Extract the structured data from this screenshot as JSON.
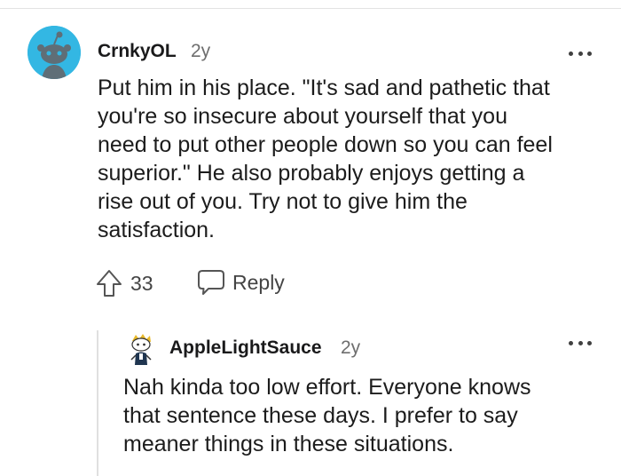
{
  "comment": {
    "username": "CrnkyOL",
    "age": "2y",
    "body_lines": [
      "Put him in his place. \"It's sad and pathetic that",
      "you're so insecure about yourself that you",
      "need to put other people down so you can feel",
      "superior.\" He also probably enjoys getting a",
      "rise out of you. Try not to give him the",
      "satisfaction."
    ],
    "upvotes": "33",
    "reply_label": "Reply",
    "avatar_color": "#33b7e3"
  },
  "reply": {
    "username": "AppleLightSauce",
    "age": "2y",
    "body_lines": [
      "Nah kinda too low effort. Everyone knows",
      "that sentence these days. I prefer to say",
      "meaner things in these situations."
    ]
  },
  "icons": {
    "avatar_main": "snoo-avatar-icon",
    "upvote": "upvote-arrow-icon",
    "reply": "speech-bubble-icon",
    "more": "more-options-icon",
    "avatar_reply": "custom-snoo-avatar-icon"
  }
}
